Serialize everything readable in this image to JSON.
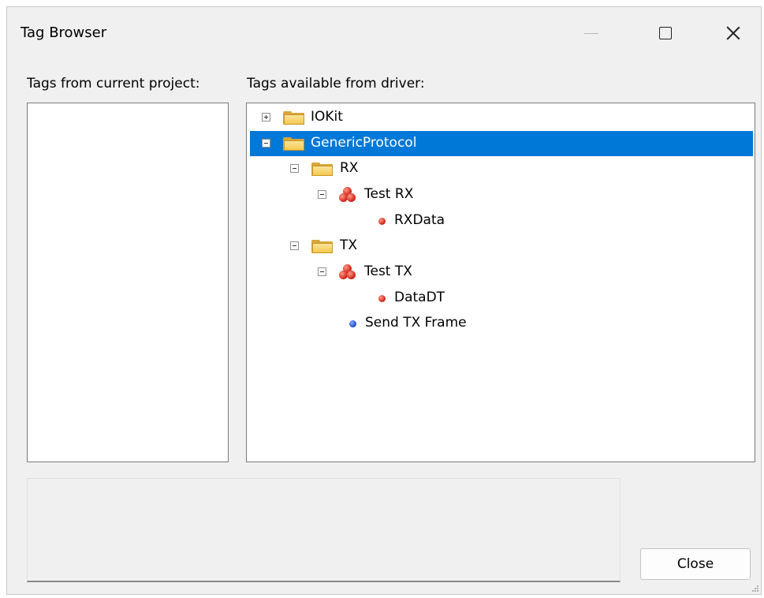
{
  "window": {
    "title": "Tag Browser"
  },
  "labels": {
    "project_tags": "Tags from current project:",
    "driver_tags": "Tags available from driver:"
  },
  "tree": {
    "nodes": [
      {
        "label": "IOKit",
        "icon": "folder-icon",
        "expander": "plus",
        "selected": false
      },
      {
        "label": "GenericProtocol",
        "icon": "folder-icon",
        "expander": "minus",
        "selected": true
      },
      {
        "label": "RX",
        "icon": "folder-icon",
        "expander": "minus",
        "selected": false
      },
      {
        "label": "Test RX",
        "icon": "red-cluster-icon",
        "expander": "minus",
        "selected": false
      },
      {
        "label": "RXData",
        "icon": "red-dot-icon",
        "expander": "none",
        "selected": false
      },
      {
        "label": "TX",
        "icon": "folder-icon",
        "expander": "minus",
        "selected": false
      },
      {
        "label": "Test TX",
        "icon": "red-cluster-icon",
        "expander": "minus",
        "selected": false
      },
      {
        "label": "DataDT",
        "icon": "red-dot-icon",
        "expander": "none",
        "selected": false
      },
      {
        "label": "Send TX Frame",
        "icon": "blue-dot-icon",
        "expander": "none",
        "selected": false
      }
    ]
  },
  "buttons": {
    "close_label": "Close"
  },
  "colors": {
    "selection": "#0078d7",
    "window_bg": "#f0f0f0",
    "folder": "#f3c94f",
    "tag_red": "#d62d20",
    "tag_blue": "#2a55d6"
  }
}
